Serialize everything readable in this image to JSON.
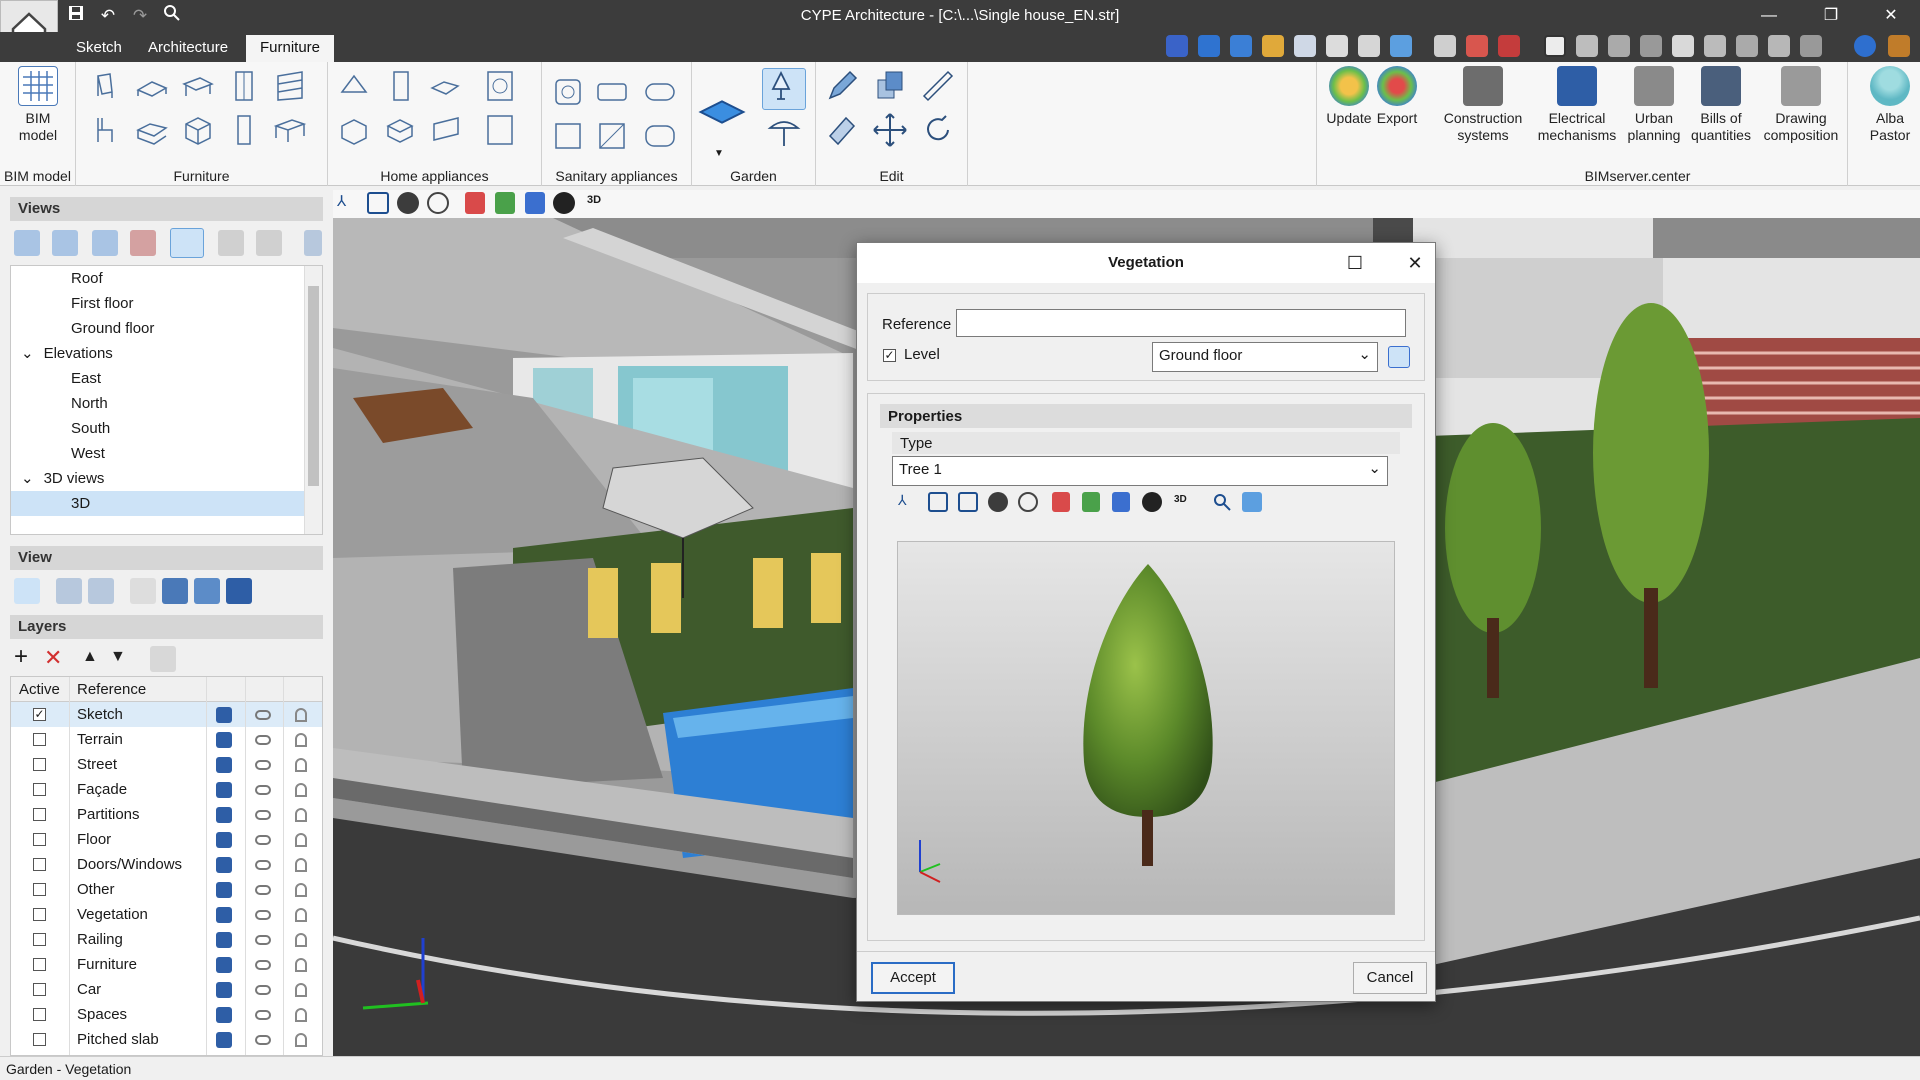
{
  "window": {
    "title": "CYPE Architecture - [C:\\...\\Single house_EN.str]",
    "controls": [
      "minimize",
      "restore",
      "close"
    ]
  },
  "ribbon": {
    "tabs": [
      {
        "label": "Sketch",
        "active": false
      },
      {
        "label": "Architecture",
        "active": false
      },
      {
        "label": "Furniture",
        "active": true
      }
    ],
    "groups": {
      "bim_model": {
        "button": "BIM\nmodel",
        "label": "BIM model"
      },
      "furniture": {
        "label": "Furniture"
      },
      "home_appliances": {
        "label": "Home appliances"
      },
      "sanitary": {
        "label": "Sanitary appliances"
      },
      "garden": {
        "label": "Garden"
      },
      "edit": {
        "label": "Edit"
      },
      "update": "Update",
      "export": "Export",
      "bimserver": {
        "label": "BIMserver.center",
        "buttons": [
          "Construction\nsystems",
          "Electrical\nmechanisms",
          "Urban\nplanning",
          "Bills of\nquantities",
          "Drawing\ncomposition"
        ]
      },
      "user": "Alba\nPastor"
    }
  },
  "views_panel": {
    "title": "Views",
    "tree": [
      {
        "label": "Roof",
        "level": 2
      },
      {
        "label": "First floor",
        "level": 2
      },
      {
        "label": "Ground floor",
        "level": 2
      },
      {
        "label": "Elevations",
        "level": 1,
        "expanded": true
      },
      {
        "label": "East",
        "level": 2
      },
      {
        "label": "North",
        "level": 2
      },
      {
        "label": "South",
        "level": 2
      },
      {
        "label": "West",
        "level": 2
      },
      {
        "label": "3D views",
        "level": 1,
        "expanded": true
      },
      {
        "label": "3D",
        "level": 2,
        "selected": true
      }
    ]
  },
  "view_panel": {
    "title": "View"
  },
  "layers_panel": {
    "title": "Layers",
    "columns": [
      "Active",
      "Reference"
    ],
    "rows": [
      {
        "name": "Sketch",
        "active": true
      },
      {
        "name": "Terrain",
        "active": false
      },
      {
        "name": "Street",
        "active": false
      },
      {
        "name": "Façade",
        "active": false
      },
      {
        "name": "Partitions",
        "active": false
      },
      {
        "name": "Floor",
        "active": false
      },
      {
        "name": "Doors/Windows",
        "active": false
      },
      {
        "name": "Other",
        "active": false
      },
      {
        "name": "Vegetation",
        "active": false
      },
      {
        "name": "Railing",
        "active": false
      },
      {
        "name": "Furniture",
        "active": false
      },
      {
        "name": "Car",
        "active": false
      },
      {
        "name": "Spaces",
        "active": false
      },
      {
        "name": "Pitched slab",
        "active": false
      }
    ]
  },
  "dialog": {
    "title": "Vegetation",
    "reference_label": "Reference",
    "reference_value": "",
    "level_label": "Level",
    "level_checked": true,
    "level_value": "Ground floor",
    "properties_label": "Properties",
    "type_label": "Type",
    "type_value": "Tree 1",
    "accept": "Accept",
    "cancel": "Cancel"
  },
  "statusbar": {
    "text": "Garden - Vegetation"
  },
  "colors": {
    "titlebar": "#3c3c3c",
    "ribbon": "#f7f7f7",
    "accent": "#2a6cc5",
    "selection": "#cde3f7"
  }
}
